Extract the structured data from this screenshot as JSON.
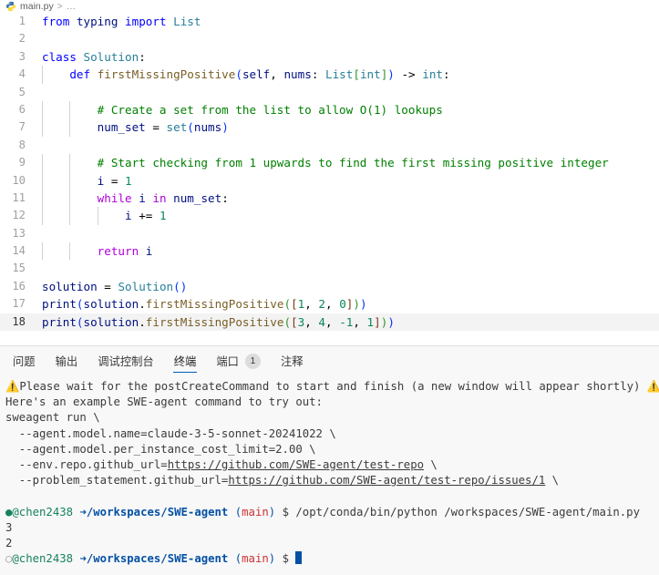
{
  "breadcrumb": {
    "icon": "python-file-icon",
    "file": "main.py",
    "separator": ">",
    "overflow": "…"
  },
  "editor": {
    "language": "python",
    "active_line": 18,
    "lines": [
      {
        "n": "1",
        "indent": 0,
        "tokens": [
          {
            "t": "from",
            "c": "t-kw"
          },
          {
            "t": " ",
            "c": "t-op"
          },
          {
            "t": "typing",
            "c": "t-var"
          },
          {
            "t": " ",
            "c": "t-op"
          },
          {
            "t": "import",
            "c": "t-kw"
          },
          {
            "t": " ",
            "c": "t-op"
          },
          {
            "t": "List",
            "c": "t-type"
          }
        ]
      },
      {
        "n": "2",
        "indent": 0,
        "tokens": []
      },
      {
        "n": "3",
        "indent": 0,
        "tokens": [
          {
            "t": "class",
            "c": "t-kw"
          },
          {
            "t": " ",
            "c": "t-op"
          },
          {
            "t": "Solution",
            "c": "t-cls"
          },
          {
            "t": ":",
            "c": "t-punct"
          }
        ]
      },
      {
        "n": "4",
        "indent": 1,
        "tokens": [
          {
            "t": "    ",
            "c": "t-op"
          },
          {
            "t": "def",
            "c": "t-kw"
          },
          {
            "t": " ",
            "c": "t-op"
          },
          {
            "t": "firstMissingPositive",
            "c": "t-fn"
          },
          {
            "t": "(",
            "c": "t-paren0"
          },
          {
            "t": "self",
            "c": "t-self"
          },
          {
            "t": ",",
            "c": "t-punct"
          },
          {
            "t": " ",
            "c": "t-op"
          },
          {
            "t": "nums",
            "c": "t-param"
          },
          {
            "t": ":",
            "c": "t-punct"
          },
          {
            "t": " ",
            "c": "t-op"
          },
          {
            "t": "List",
            "c": "t-type"
          },
          {
            "t": "[",
            "c": "t-paren1"
          },
          {
            "t": "int",
            "c": "t-type"
          },
          {
            "t": "]",
            "c": "t-paren1"
          },
          {
            "t": ")",
            "c": "t-paren0"
          },
          {
            "t": " ",
            "c": "t-op"
          },
          {
            "t": "->",
            "c": "t-op"
          },
          {
            "t": " ",
            "c": "t-op"
          },
          {
            "t": "int",
            "c": "t-type"
          },
          {
            "t": ":",
            "c": "t-punct"
          }
        ]
      },
      {
        "n": "5",
        "indent": 2,
        "tokens": []
      },
      {
        "n": "6",
        "indent": 2,
        "tokens": [
          {
            "t": "        ",
            "c": "t-op"
          },
          {
            "t": "# Create a set from the list to allow O(1) lookups",
            "c": "t-cmt"
          }
        ]
      },
      {
        "n": "7",
        "indent": 2,
        "tokens": [
          {
            "t": "        ",
            "c": "t-op"
          },
          {
            "t": "num_set",
            "c": "t-var"
          },
          {
            "t": " ",
            "c": "t-op"
          },
          {
            "t": "=",
            "c": "t-op"
          },
          {
            "t": " ",
            "c": "t-op"
          },
          {
            "t": "set",
            "c": "t-type"
          },
          {
            "t": "(",
            "c": "t-paren0"
          },
          {
            "t": "nums",
            "c": "t-var"
          },
          {
            "t": ")",
            "c": "t-paren0"
          }
        ]
      },
      {
        "n": "8",
        "indent": 2,
        "tokens": []
      },
      {
        "n": "9",
        "indent": 2,
        "tokens": [
          {
            "t": "        ",
            "c": "t-op"
          },
          {
            "t": "# Start checking from 1 upwards to find the first missing positive integer",
            "c": "t-cmt"
          }
        ]
      },
      {
        "n": "10",
        "indent": 2,
        "tokens": [
          {
            "t": "        ",
            "c": "t-op"
          },
          {
            "t": "i",
            "c": "t-var"
          },
          {
            "t": " ",
            "c": "t-op"
          },
          {
            "t": "=",
            "c": "t-op"
          },
          {
            "t": " ",
            "c": "t-op"
          },
          {
            "t": "1",
            "c": "t-num"
          }
        ]
      },
      {
        "n": "11",
        "indent": 2,
        "tokens": [
          {
            "t": "        ",
            "c": "t-op"
          },
          {
            "t": "while",
            "c": "t-kw2"
          },
          {
            "t": " ",
            "c": "t-op"
          },
          {
            "t": "i",
            "c": "t-var"
          },
          {
            "t": " ",
            "c": "t-op"
          },
          {
            "t": "in",
            "c": "t-kw2"
          },
          {
            "t": " ",
            "c": "t-op"
          },
          {
            "t": "num_set",
            "c": "t-var"
          },
          {
            "t": ":",
            "c": "t-punct"
          }
        ]
      },
      {
        "n": "12",
        "indent": 3,
        "tokens": [
          {
            "t": "            ",
            "c": "t-op"
          },
          {
            "t": "i",
            "c": "t-var"
          },
          {
            "t": " ",
            "c": "t-op"
          },
          {
            "t": "+=",
            "c": "t-op"
          },
          {
            "t": " ",
            "c": "t-op"
          },
          {
            "t": "1",
            "c": "t-num"
          }
        ]
      },
      {
        "n": "13",
        "indent": 2,
        "tokens": []
      },
      {
        "n": "14",
        "indent": 2,
        "tokens": [
          {
            "t": "        ",
            "c": "t-op"
          },
          {
            "t": "return",
            "c": "t-kw2"
          },
          {
            "t": " ",
            "c": "t-op"
          },
          {
            "t": "i",
            "c": "t-var"
          }
        ]
      },
      {
        "n": "15",
        "indent": 0,
        "tokens": []
      },
      {
        "n": "16",
        "indent": 0,
        "tokens": [
          {
            "t": "solution",
            "c": "t-var"
          },
          {
            "t": " ",
            "c": "t-op"
          },
          {
            "t": "=",
            "c": "t-op"
          },
          {
            "t": " ",
            "c": "t-op"
          },
          {
            "t": "Solution",
            "c": "t-cls"
          },
          {
            "t": "(",
            "c": "t-paren0"
          },
          {
            "t": ")",
            "c": "t-paren0"
          }
        ]
      },
      {
        "n": "17",
        "indent": 0,
        "tokens": [
          {
            "t": "print",
            "c": "t-var"
          },
          {
            "t": "(",
            "c": "t-paren0"
          },
          {
            "t": "solution",
            "c": "t-var"
          },
          {
            "t": ".",
            "c": "t-punct"
          },
          {
            "t": "firstMissingPositive",
            "c": "t-fn"
          },
          {
            "t": "(",
            "c": "t-paren1"
          },
          {
            "t": "[",
            "c": "t-paren2"
          },
          {
            "t": "1",
            "c": "t-num"
          },
          {
            "t": ",",
            "c": "t-punct"
          },
          {
            "t": " ",
            "c": "t-op"
          },
          {
            "t": "2",
            "c": "t-num"
          },
          {
            "t": ",",
            "c": "t-punct"
          },
          {
            "t": " ",
            "c": "t-op"
          },
          {
            "t": "0",
            "c": "t-num"
          },
          {
            "t": "]",
            "c": "t-paren2"
          },
          {
            "t": ")",
            "c": "t-paren1"
          },
          {
            "t": ")",
            "c": "t-paren0"
          }
        ]
      },
      {
        "n": "18",
        "indent": 0,
        "tokens": [
          {
            "t": "print",
            "c": "t-var"
          },
          {
            "t": "(",
            "c": "t-paren0"
          },
          {
            "t": "solution",
            "c": "t-var"
          },
          {
            "t": ".",
            "c": "t-punct"
          },
          {
            "t": "firstMissingPositive",
            "c": "t-fn"
          },
          {
            "t": "(",
            "c": "t-paren1"
          },
          {
            "t": "[",
            "c": "t-paren2"
          },
          {
            "t": "3",
            "c": "t-num"
          },
          {
            "t": ",",
            "c": "t-punct"
          },
          {
            "t": " ",
            "c": "t-op"
          },
          {
            "t": "4",
            "c": "t-num"
          },
          {
            "t": ",",
            "c": "t-punct"
          },
          {
            "t": " ",
            "c": "t-op"
          },
          {
            "t": "-1",
            "c": "t-num"
          },
          {
            "t": ",",
            "c": "t-punct"
          },
          {
            "t": " ",
            "c": "t-op"
          },
          {
            "t": "1",
            "c": "t-num"
          },
          {
            "t": "]",
            "c": "t-paren2"
          },
          {
            "t": ")",
            "c": "t-paren1"
          },
          {
            "t": ")",
            "c": "t-paren0"
          }
        ]
      }
    ]
  },
  "panel": {
    "tabs": [
      {
        "label": "问题",
        "active": false,
        "badge": null
      },
      {
        "label": "输出",
        "active": false,
        "badge": null
      },
      {
        "label": "调试控制台",
        "active": false,
        "badge": null
      },
      {
        "label": "终端",
        "active": true,
        "badge": null
      },
      {
        "label": "端口",
        "active": false,
        "badge": "1"
      },
      {
        "label": "注释",
        "active": false,
        "badge": null
      }
    ],
    "terminal": {
      "lines": [
        {
          "type": "warn",
          "glyph_left": "⚠️",
          "glyph_right": "⚠️",
          "text": "Please wait for the postCreateCommand to start and finish (a new window will appear shortly)"
        },
        {
          "type": "plain",
          "text": "Here's an example SWE-agent command to try out:"
        },
        {
          "type": "plain",
          "text": "sweagent run \\"
        },
        {
          "type": "plain",
          "text": "  --agent.model.name=claude-3-5-sonnet-20241022 \\"
        },
        {
          "type": "plain",
          "text": "  --agent.model.per_instance_cost_limit=2.00 \\"
        },
        {
          "type": "link",
          "pre": "  --env.repo.github_url=",
          "link": "https://github.com/SWE-agent/test-repo",
          "post": " \\"
        },
        {
          "type": "link",
          "pre": "  --problem_statement.github_url=",
          "link": "https://github.com/SWE-agent/test-repo/issues/1",
          "post": " \\"
        },
        {
          "type": "blank",
          "text": ""
        },
        {
          "type": "prompt",
          "dot": "●",
          "user": "@chen2438",
          "arrow": "➜",
          "path": "/workspaces/SWE-agent",
          "branch": "main",
          "dollar": "$",
          "command": " /opt/conda/bin/python /workspaces/SWE-agent/main.py"
        },
        {
          "type": "plain",
          "text": "3"
        },
        {
          "type": "plain",
          "text": "2"
        },
        {
          "type": "prompt-cursor",
          "dot": "○",
          "user": "@chen2438",
          "arrow": "➜",
          "path": "/workspaces/SWE-agent",
          "branch": "main",
          "dollar": "$",
          "command": ""
        }
      ]
    }
  },
  "colors": {
    "accent": "#005fb8",
    "editor_bg": "#ffffff",
    "panel_bg": "#f8f8f8",
    "active_line_bg": "#f3f3f3",
    "warning": "#e8a33d",
    "prompt_user": "#16825d",
    "prompt_path": "#0451a5",
    "prompt_branch": "#cd3131"
  }
}
